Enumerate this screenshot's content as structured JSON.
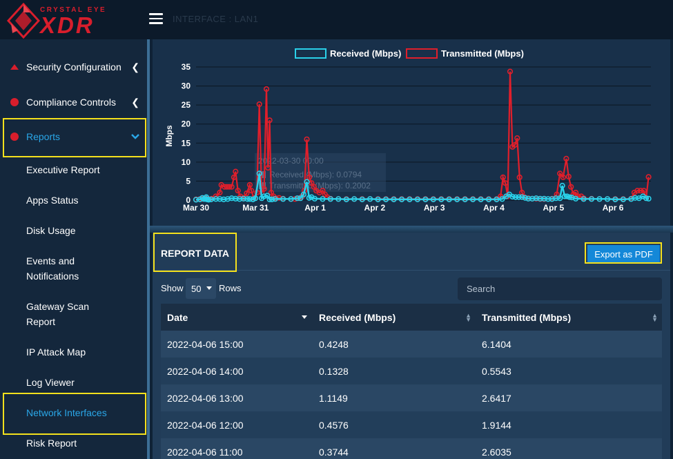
{
  "header": {
    "logo_small": "CRYSTAL EYE",
    "logo_big": "XDR",
    "page_heading": "INTERFACE : LAN1"
  },
  "sidebar": {
    "items": [
      {
        "label": "Security Configuration",
        "icon": "triangle-icon"
      },
      {
        "label": "Compliance Controls",
        "icon": "circle-icon"
      },
      {
        "label": "Reports",
        "icon": "circle-icon",
        "active": true
      }
    ],
    "sub_items": [
      "Executive Report",
      "Apps Status",
      "Disk Usage",
      "Events and Notifications",
      "Gateway Scan Report",
      "IP Attack Map",
      "Log Viewer",
      "Network Interfaces",
      "Risk Report"
    ],
    "active_sub_item": "Network Interfaces"
  },
  "chart_data": {
    "type": "line",
    "ylabel": "Mbps",
    "ylim": [
      0,
      35
    ],
    "yticks": [
      "35",
      "30",
      "25",
      "20",
      "15",
      "10",
      "5",
      "0"
    ],
    "xticks": [
      "Mar 30",
      "Mar 31",
      "Apr 1",
      "Apr 2",
      "Apr 3",
      "Apr 4",
      "Apr 5",
      "Apr 6"
    ],
    "legend_position": "top",
    "tooltip": {
      "title": "2022-03-30 00:00",
      "received": "Received (Mbps): 0.0794",
      "transmitted": "Transmitted (Mbps): 0.2002"
    },
    "series": [
      {
        "name": "Received (Mbps)",
        "color": "#2ad1ea",
        "points": [
          [
            0,
            0.1
          ],
          [
            0.5,
            0.2
          ],
          [
            0.8,
            0.6
          ],
          [
            1,
            0.3
          ],
          [
            1.2,
            0.3
          ],
          [
            1.3,
            0.8
          ],
          [
            1.4,
            0.2
          ],
          [
            1.6,
            0.1
          ],
          [
            1.9,
            0.2
          ],
          [
            2.5,
            0.3
          ],
          [
            3.0,
            0.3
          ],
          [
            3.5,
            0.2
          ],
          [
            4.0,
            0.3
          ],
          [
            4.5,
            0.5
          ],
          [
            5.0,
            0.4
          ],
          [
            5.5,
            0.3
          ],
          [
            6.0,
            0.4
          ],
          [
            6.5,
            0.3
          ],
          [
            6.8,
            0.3
          ],
          [
            7.2,
            0.2
          ],
          [
            7.5,
            0.5
          ],
          [
            8.0,
            7.0
          ],
          [
            8.3,
            0.5
          ],
          [
            8.6,
            1.0
          ],
          [
            9.0,
            1.2
          ],
          [
            9.3,
            0.2
          ],
          [
            9.6,
            0.2
          ],
          [
            10,
            0.3
          ],
          [
            11,
            0.3
          ],
          [
            12,
            0.3
          ],
          [
            12.8,
            0.5
          ],
          [
            13.2,
            0.5
          ],
          [
            13.6,
            1.5
          ],
          [
            14.0,
            4.8
          ],
          [
            14.3,
            0.6
          ],
          [
            14.6,
            0.8
          ],
          [
            15,
            0.4
          ],
          [
            16,
            0.3
          ],
          [
            17,
            0.3
          ],
          [
            18,
            0.3
          ],
          [
            19,
            0.2
          ],
          [
            20,
            0.3
          ],
          [
            21,
            0.2
          ],
          [
            22,
            0.3
          ],
          [
            23,
            0.2
          ],
          [
            24,
            0.2
          ],
          [
            25,
            0.2
          ],
          [
            26,
            0.2
          ],
          [
            27,
            0.2
          ],
          [
            28,
            0.2
          ],
          [
            29,
            0.2
          ],
          [
            30,
            0.2
          ],
          [
            31,
            0.2
          ],
          [
            32,
            0.2
          ],
          [
            33,
            0.2
          ],
          [
            34,
            0.2
          ],
          [
            35,
            0.2
          ],
          [
            36,
            0.2
          ],
          [
            37,
            0.2
          ],
          [
            38,
            0.2
          ],
          [
            38.7,
            0.3
          ],
          [
            39.2,
            1.0
          ],
          [
            39.6,
            1.5
          ],
          [
            40.0,
            0.9
          ],
          [
            40.4,
            0.8
          ],
          [
            40.8,
            0.8
          ],
          [
            41.2,
            0.8
          ],
          [
            41.6,
            0.6
          ],
          [
            42,
            0.4
          ],
          [
            42.5,
            0.4
          ],
          [
            43,
            0.5
          ],
          [
            43.5,
            0.4
          ],
          [
            44,
            0.4
          ],
          [
            44.5,
            0.3
          ],
          [
            45,
            0.3
          ],
          [
            45.5,
            0.5
          ],
          [
            46,
            0.5
          ],
          [
            46.3,
            3.8
          ],
          [
            46.6,
            1.0
          ],
          [
            46.9,
            1.0
          ],
          [
            47.2,
            0.8
          ],
          [
            47.5,
            0.7
          ],
          [
            48,
            0.4
          ],
          [
            49,
            0.3
          ],
          [
            50,
            0.3
          ],
          [
            51,
            0.3
          ],
          [
            52,
            0.3
          ],
          [
            53,
            0.2
          ],
          [
            54,
            0.2
          ],
          [
            55,
            0.3
          ],
          [
            55.5,
            0.6
          ],
          [
            56,
            0.5
          ],
          [
            56.5,
            1.0
          ],
          [
            56.9,
            0.5
          ],
          [
            57.2,
            0.4
          ]
        ]
      },
      {
        "name": "Transmitted (Mbps)",
        "color": "#e01f2b",
        "points": [
          [
            0,
            0.2
          ],
          [
            0.5,
            0.3
          ],
          [
            0.8,
            0.3
          ],
          [
            1.2,
            0.5
          ],
          [
            1.5,
            0.4
          ],
          [
            2.0,
            0.4
          ],
          [
            2.5,
            1.0
          ],
          [
            3.0,
            2.0
          ],
          [
            3.2,
            4.0
          ],
          [
            3.6,
            3.5
          ],
          [
            3.9,
            3.5
          ],
          [
            4.2,
            3.5
          ],
          [
            4.5,
            3.5
          ],
          [
            4.8,
            6.0
          ],
          [
            5.0,
            7.5
          ],
          [
            5.3,
            2.5
          ],
          [
            5.6,
            1.0
          ],
          [
            6.0,
            0.6
          ],
          [
            6.4,
            1.8
          ],
          [
            6.8,
            4.0
          ],
          [
            7.0,
            2.5
          ],
          [
            7.3,
            0.6
          ],
          [
            7.7,
            2.0
          ],
          [
            8.0,
            25.2
          ],
          [
            8.3,
            2.0
          ],
          [
            8.6,
            3.0
          ],
          [
            8.9,
            29.2
          ],
          [
            9.1,
            8.5
          ],
          [
            9.3,
            21.0
          ],
          [
            9.5,
            2.0
          ],
          [
            9.8,
            1.0
          ],
          [
            10.1,
            0.5
          ],
          [
            10.5,
            0.6
          ],
          [
            11,
            0.4
          ],
          [
            12,
            0.3
          ],
          [
            12.5,
            0.3
          ],
          [
            13.0,
            0.5
          ],
          [
            13.4,
            1.0
          ],
          [
            13.7,
            2.5
          ],
          [
            14.0,
            16.0
          ],
          [
            14.3,
            6.0
          ],
          [
            14.6,
            4.5
          ],
          [
            14.9,
            3.5
          ],
          [
            15.2,
            2.5
          ],
          [
            15.6,
            2.0
          ],
          [
            16.0,
            2.5
          ],
          [
            16.3,
            1.5
          ],
          [
            16.6,
            0.8
          ],
          [
            17.0,
            0.4
          ],
          [
            18,
            0.3
          ],
          [
            19,
            0.3
          ],
          [
            20,
            0.3
          ],
          [
            21,
            0.3
          ],
          [
            22,
            0.3
          ],
          [
            23,
            0.3
          ],
          [
            24,
            0.3
          ],
          [
            25,
            0.3
          ],
          [
            26,
            0.3
          ],
          [
            27,
            0.3
          ],
          [
            28,
            0.3
          ],
          [
            29,
            0.3
          ],
          [
            30,
            0.3
          ],
          [
            31,
            0.3
          ],
          [
            32,
            0.3
          ],
          [
            33,
            0.3
          ],
          [
            34,
            0.3
          ],
          [
            35,
            0.3
          ],
          [
            36,
            0.3
          ],
          [
            37,
            0.3
          ],
          [
            38,
            0.3
          ],
          [
            38.5,
            1.0
          ],
          [
            38.8,
            6.0
          ],
          [
            39.1,
            4.5
          ],
          [
            39.4,
            1.0
          ],
          [
            39.7,
            33.8
          ],
          [
            40.0,
            14.0
          ],
          [
            40.3,
            14.5
          ],
          [
            40.6,
            16.3
          ],
          [
            40.9,
            6.0
          ],
          [
            41.2,
            2.0
          ],
          [
            41.5,
            0.8
          ],
          [
            42,
            0.5
          ],
          [
            42.5,
            0.4
          ],
          [
            43,
            0.4
          ],
          [
            43.5,
            0.3
          ],
          [
            44,
            0.3
          ],
          [
            45,
            0.4
          ],
          [
            45.6,
            1.5
          ],
          [
            46.0,
            7.0
          ],
          [
            46.4,
            6.0
          ],
          [
            46.8,
            10.9
          ],
          [
            47.1,
            6.2
          ],
          [
            47.4,
            3.5
          ],
          [
            47.7,
            1.5
          ],
          [
            48.0,
            2.0
          ],
          [
            48.3,
            1.0
          ],
          [
            48.7,
            1.0
          ],
          [
            49,
            0.5
          ],
          [
            50,
            0.4
          ],
          [
            51,
            0.3
          ],
          [
            52,
            0.3
          ],
          [
            53,
            0.3
          ],
          [
            54,
            0.3
          ],
          [
            55,
            0.4
          ],
          [
            55.4,
            2.0
          ],
          [
            55.8,
            2.5
          ],
          [
            56.2,
            2.5
          ],
          [
            56.6,
            2.5
          ],
          [
            56.9,
            0.5
          ],
          [
            57.2,
            6.1
          ]
        ]
      }
    ]
  },
  "report": {
    "title": "REPORT DATA",
    "export_label": "Export as PDF",
    "show_label": "Show",
    "rows_value": "50",
    "rows_label": "Rows",
    "search_placeholder": "Search",
    "columns": [
      "Date",
      "Received (Mbps)",
      "Transmitted (Mbps)"
    ],
    "rows": [
      [
        "2022-04-06 15:00",
        "0.4248",
        "6.1404"
      ],
      [
        "2022-04-06 14:00",
        "0.1328",
        "0.5543"
      ],
      [
        "2022-04-06 13:00",
        "1.1149",
        "2.6417"
      ],
      [
        "2022-04-06 12:00",
        "0.4576",
        "1.9144"
      ],
      [
        "2022-04-06 11:00",
        "0.3744",
        "2.6035"
      ]
    ]
  },
  "colors": {
    "accent": "#2aa7e8",
    "highlight": "#f5e11c",
    "brand": "#d81e2c"
  }
}
